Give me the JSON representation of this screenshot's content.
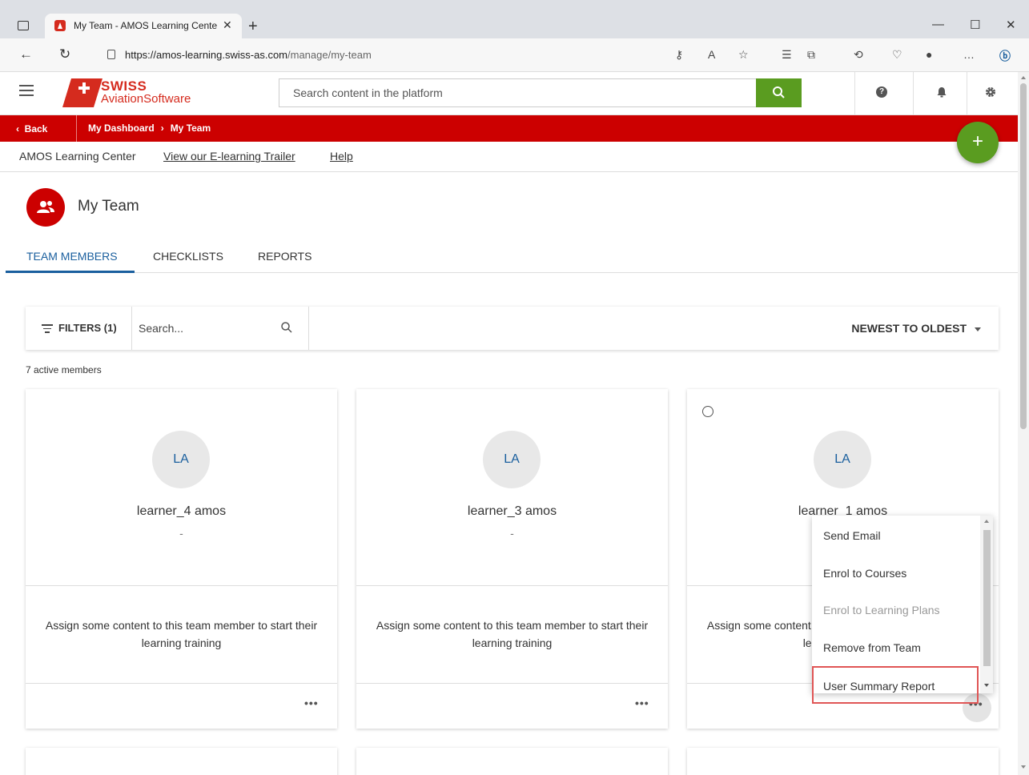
{
  "browser": {
    "tab_title": "My Team - AMOS Learning Cente",
    "new_tab": "+",
    "url_host": "https://amos-learning.swiss-as.com",
    "url_path": "/manage/my-team"
  },
  "header": {
    "logo_swiss": "SWISS",
    "logo_aviation": "AviationSoftware",
    "search_placeholder": "Search content in the platform"
  },
  "breadcrumb": {
    "back": "Back",
    "dashboard": "My Dashboard",
    "current": "My Team"
  },
  "subnav": {
    "home": "AMOS Learning Center",
    "trailer": "View our E-learning Trailer",
    "help": "Help"
  },
  "fab_label": "+",
  "page": {
    "title": "My Team",
    "tabs": [
      "TEAM MEMBERS",
      "CHECKLISTS",
      "REPORTS"
    ]
  },
  "filterbar": {
    "filters_label": "FILTERS (1)",
    "search_placeholder": "Search...",
    "sort_label": "NEWEST TO OLDEST"
  },
  "member_count": "7 active members",
  "cards": [
    {
      "initials": "LA",
      "name": "learner_4 amos",
      "subtitle": "-",
      "message": "Assign some content to this team member to start their learning training"
    },
    {
      "initials": "LA",
      "name": "learner_3 amos",
      "subtitle": "-",
      "message": "Assign some content to this team member to start their learning training"
    },
    {
      "initials": "LA",
      "name": "learner_1 amos",
      "subtitle": "-",
      "message": "Assign some content to this team member to start their learning training"
    }
  ],
  "menu": {
    "items": [
      "Send Email",
      "Enrol to Courses",
      "Enrol to Learning Plans",
      "Remove from Team",
      "User Summary Report"
    ]
  },
  "colors": {
    "brand_red": "#cc0000",
    "accent_green": "#5a9c20",
    "link_blue": "#1a5f9e"
  }
}
